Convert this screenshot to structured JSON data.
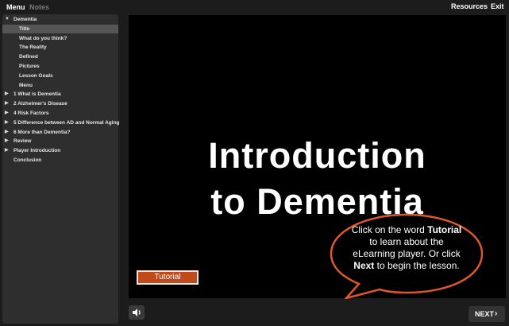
{
  "topbar": {
    "tabs": [
      "Menu",
      "Notes"
    ],
    "resources": "Resources",
    "exit": "Exit"
  },
  "menu": [
    {
      "label": "Dementia",
      "level": 0,
      "toggle": "open"
    },
    {
      "label": "Title",
      "level": 1,
      "selected": true
    },
    {
      "label": "What do you think?",
      "level": 1
    },
    {
      "label": "The Reality",
      "level": 1
    },
    {
      "label": "Defined",
      "level": 1
    },
    {
      "label": "Pictures",
      "level": 1
    },
    {
      "label": "Lesson Goals",
      "level": 1
    },
    {
      "label": "Menu",
      "level": 1
    },
    {
      "label": "1 What is Dementia",
      "level": 0,
      "toggle": "closed"
    },
    {
      "label": "2 Alzheimer's Disease",
      "level": 0,
      "toggle": "closed"
    },
    {
      "label": "4 Risk Factors",
      "level": 0,
      "toggle": "closed"
    },
    {
      "label": "5 Difference between AD and Normal Aging",
      "level": 0,
      "toggle": "closed"
    },
    {
      "label": "6 More than Dementia?",
      "level": 0,
      "toggle": "closed"
    },
    {
      "label": "Review",
      "level": 0,
      "toggle": "closed"
    },
    {
      "label": "Player Introduction",
      "level": 0,
      "toggle": "closed"
    },
    {
      "label": "Conclusion",
      "level": 0
    }
  ],
  "slide": {
    "title_line1": "Introduction",
    "title_line2": "to Dementia",
    "tutorial_button": "Tutorial",
    "callout": {
      "t1": "Click on the word ",
      "b1": "Tutorial",
      "t2": " to learn about the eLearning player.  Or click ",
      "b2": "Next",
      "t3": " to begin the lesson."
    }
  },
  "controls": {
    "next": "NEXT",
    "sound_icon": "speaker-icon"
  },
  "colors": {
    "accent_orange": "#c14a1b",
    "callout_border": "#e0562a"
  }
}
